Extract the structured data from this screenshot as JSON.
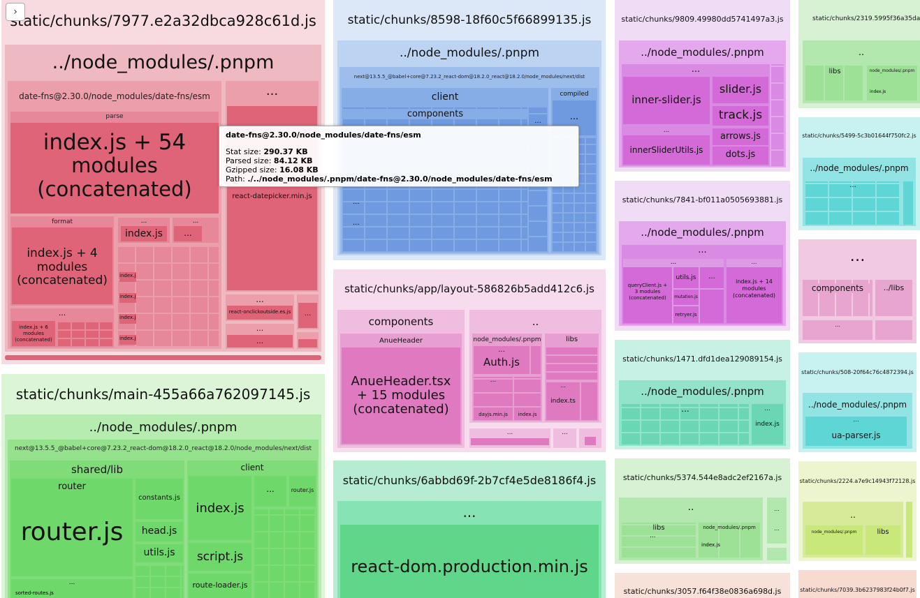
{
  "toggle": {
    "icon": "chevron-right-icon",
    "glyph": "›"
  },
  "tooltip": {
    "title": "date-fns@2.30.0/node_modules/date-fns/esm",
    "stat_label": "Stat size:",
    "stat_value": "290.37 KB",
    "parsed_label": "Parsed size:",
    "parsed_value": "84.12 KB",
    "gzip_label": "Gzipped size:",
    "gzip_value": "16.08 KB",
    "path_label": "Path:",
    "path_value": "./../node_modules/.pnpm/date-fns@2.30.0/node_modules/date-fns/esm"
  },
  "colors": {
    "red": "#e06b7d",
    "blue": "#6f9ae0",
    "green": "#6fd86a",
    "pink": "#e07ac0",
    "mint": "#5fd69b",
    "purple": "#d469d8",
    "cyan": "#5fd6d6",
    "lime": "#c9e87a",
    "peach": "#f2c5b5"
  },
  "ellipsis": "...",
  "dots": "…",
  "dotdot": "..",
  "pnpm": "../node_modules/.pnpm",
  "next_dist": "next@13.5.5_@babel+core@7.23.2_react-dom@18.2.0_react@18.2.0/node_modules/next/dist",
  "chunk7977": {
    "title": "static/chunks/7977.e2a32dbca928c61d.js",
    "datefns": "date-fns@2.30.0/node_modules/date-fns/esm",
    "parse": "parse",
    "index54": [
      "index.js + 54",
      "modules",
      "(concatenated)"
    ],
    "format": "format",
    "index4": [
      "index.js + 4",
      "modules",
      "(concatenated)"
    ],
    "indexjs": "index.js",
    "index6": [
      "index.js + 6",
      "modules",
      "(concatenated)"
    ],
    "datepicker": "react-datepicker.min.js",
    "onclick": "react-onclickoutside.es.js"
  },
  "chunkMain": {
    "title": "static/chunks/main-455a66a762097145.js",
    "sharedlib": "shared/lib",
    "client": "client",
    "router": "router",
    "routerjs": "router.js",
    "constants": "constants.js",
    "head": "head.js",
    "utils": "utils.js",
    "indexjs": "index.js",
    "script": "script.js",
    "routeloader": "route-loader.js",
    "routerjs_small": "router.js",
    "sorted": "sorted-routes.js"
  },
  "chunk8598": {
    "title": "static/chunks/8598-18f60c5f66899135.js",
    "client": "client",
    "compiled": "compiled",
    "components": "components"
  },
  "chunkLayout": {
    "title": "static/chunks/app/layout-586826b5add412c6.js",
    "components": "components",
    "anueheader": "AnueHeader",
    "anuetsx": [
      "AnueHeader.tsx",
      "+ 15 modules",
      "(concatenated)"
    ],
    "nm": "node_modules/.pnpm",
    "libs": "libs",
    "auth": "Auth.js",
    "indexts": "index.ts",
    "dayjs": "dayjs.min.js",
    "indexjs": "index.js"
  },
  "chunk6abbd": {
    "title": "static/chunks/6abbd69f-2b7cf4e5de8186f4.js",
    "reactdom": "react-dom.production.min.js"
  },
  "chunk9809": {
    "title": "static/chunks/9809.49980dd5741497a3.js",
    "inner": "inner-slider.js",
    "slider": "slider.js",
    "track": "track.js",
    "arrows": "arrows.js",
    "dots": "dots.js",
    "utils": "innerSliderUtils.js"
  },
  "chunk7841": {
    "title": "static/chunks/7841-bf011a0505693881.js",
    "query": [
      "queryClient.js +",
      "3 modules",
      "(concatenated)"
    ],
    "utils": "utils.js",
    "mutation": "mutation.js",
    "retryer": "retryer.js",
    "index14": [
      "index.js + 14",
      "modules",
      "(concatenated)"
    ]
  },
  "chunk1471": {
    "title": "static/chunks/1471.dfd1dea129089154.js",
    "indexjs": "index.js"
  },
  "chunk5374": {
    "title": "static/chunks/5374.544e8adc2ef2167a.js",
    "libs": "libs",
    "nm": "node_modules/.pnpm",
    "indexjs": "index.js"
  },
  "chunk3057": {
    "title": "static/chunks/3057.f64f38e0836a698d.js"
  },
  "chunk2319": {
    "title": "static/chunks/2319.5995f36a35dab94",
    "libs": "libs",
    "nm": "node_modules/.pnpm",
    "indexjs": "index.js"
  },
  "chunk5499": {
    "title": "static/chunks/5499-5c3b01644f750fc2.js"
  },
  "chunkPinkSmall": {
    "components": "components",
    "libs": "../libs"
  },
  "chunk508": {
    "title": "static/chunks/508-20f64c76c4872394.js",
    "ua": "ua-parser.js"
  },
  "chunk2224": {
    "title": "static/chunks/2224.a7e9c14943f72128.js",
    "nm": "node_modules/.pnpm",
    "libs": "libs"
  },
  "chunk7039": {
    "title": "static/chunks/7039.3b6237983f24b0f7.js"
  }
}
